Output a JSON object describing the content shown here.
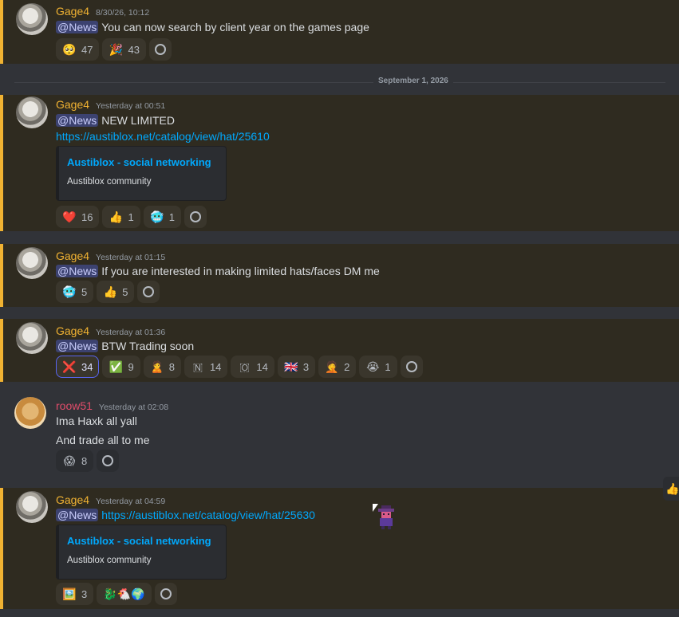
{
  "date_divider": "September 1, 2026",
  "messages": [
    {
      "author": "Gage4",
      "timestamp": "8/30/26, 10:12",
      "mention": "@News",
      "text": "You can now search by client year on the games page",
      "reactions": [
        {
          "emoji": "🥺",
          "count": "47"
        },
        {
          "emoji": "🎉",
          "count": "43"
        }
      ]
    },
    {
      "author": "Gage4",
      "timestamp": "Yesterday at 00:51",
      "mention": "@News",
      "text": "NEW LIMITED",
      "link": "https://austiblox.net/catalog/view/hat/25610",
      "embed": {
        "title": "Austiblox - social networking",
        "description": "Austiblox community"
      },
      "reactions": [
        {
          "emoji": "❤️",
          "count": "16"
        },
        {
          "emoji": "👍",
          "count": "1"
        },
        {
          "emoji": "🥶",
          "count": "1"
        }
      ]
    },
    {
      "author": "Gage4",
      "timestamp": "Yesterday at 01:15",
      "mention": "@News",
      "text": "If you are interested in making limited hats/faces DM me",
      "reactions": [
        {
          "emoji": "🥶",
          "count": "5"
        },
        {
          "emoji": "👍",
          "count": "5"
        }
      ]
    },
    {
      "author": "Gage4",
      "timestamp": "Yesterday at 01:36",
      "mention": "@News",
      "text": "BTW Trading soon",
      "reactions": [
        {
          "emoji": "❌",
          "count": "34"
        },
        {
          "emoji": "✅",
          "count": "9"
        },
        {
          "emoji": "🙎",
          "count": "8"
        },
        {
          "emoji": "🇳",
          "count": "14"
        },
        {
          "emoji": "🇴",
          "count": "14"
        },
        {
          "emoji": "🇬🇧",
          "count": "3"
        },
        {
          "emoji": "🤦",
          "count": "2"
        },
        {
          "emoji": "😭",
          "count": "1"
        }
      ]
    },
    {
      "author": "roow51",
      "timestamp": "Yesterday at 02:08",
      "lines": [
        "Ima Haxk all yall",
        "And trade all to me"
      ],
      "reactions": [
        {
          "emoji": "😱",
          "count": "8"
        }
      ]
    },
    {
      "author": "Gage4",
      "timestamp": "Yesterday at 04:59",
      "mention": "@News",
      "link": "https://austiblox.net/catalog/view/hat/25630",
      "embed": {
        "title": "Austiblox - social networking",
        "description": "Austiblox community"
      },
      "reactions": [
        {
          "emoji": "🖼️",
          "count": "3"
        },
        {
          "emoji": "🐉🐔🌍",
          "count": ""
        }
      ]
    }
  ],
  "floating_reaction": "👍",
  "colors": {
    "mention_bg": "#2f2b20",
    "mention_bar": "#f0b232",
    "link": "#00a8fc",
    "gage": "#f0b232",
    "roow": "#e04c6a"
  },
  "icons": [
    "add-reaction-icon",
    "cursor-icon"
  ]
}
